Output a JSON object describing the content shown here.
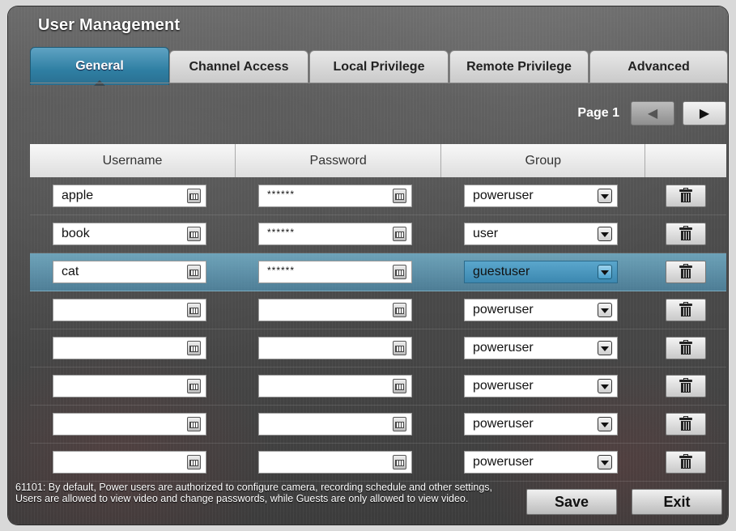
{
  "window": {
    "title": "User Management"
  },
  "tabs": [
    {
      "label": "General",
      "active": true
    },
    {
      "label": "Channel Access",
      "active": false
    },
    {
      "label": "Local Privilege",
      "active": false
    },
    {
      "label": "Remote Privilege",
      "active": false
    },
    {
      "label": "Advanced",
      "active": false
    }
  ],
  "pager": {
    "label": "Page 1"
  },
  "table": {
    "headers": [
      "Username",
      "Password",
      "Group",
      ""
    ],
    "rows": [
      {
        "username": "apple",
        "password": "******",
        "group": "poweruser",
        "selected": false
      },
      {
        "username": "book",
        "password": "******",
        "group": "user",
        "selected": false
      },
      {
        "username": "cat",
        "password": "******",
        "group": "guestuser",
        "selected": true
      },
      {
        "username": "",
        "password": "",
        "group": "poweruser",
        "selected": false
      },
      {
        "username": "",
        "password": "",
        "group": "poweruser",
        "selected": false
      },
      {
        "username": "",
        "password": "",
        "group": "poweruser",
        "selected": false
      },
      {
        "username": "",
        "password": "",
        "group": "poweruser",
        "selected": false
      },
      {
        "username": "",
        "password": "",
        "group": "poweruser",
        "selected": false
      }
    ]
  },
  "footer": {
    "note": "61101: By default, Power users are authorized to configure camera, recording schedule and other settings, Users are allowed to view video and change passwords, while Guests are only allowed to view video.",
    "save_label": "Save",
    "exit_label": "Exit"
  },
  "colors": {
    "active_tab": "#2f7fa3",
    "selected_row": "#5aa6cc"
  },
  "icons": [
    "keyboard-icon",
    "dropdown-arrow-icon",
    "trash-icon",
    "arrow-left-icon",
    "arrow-right-icon"
  ]
}
